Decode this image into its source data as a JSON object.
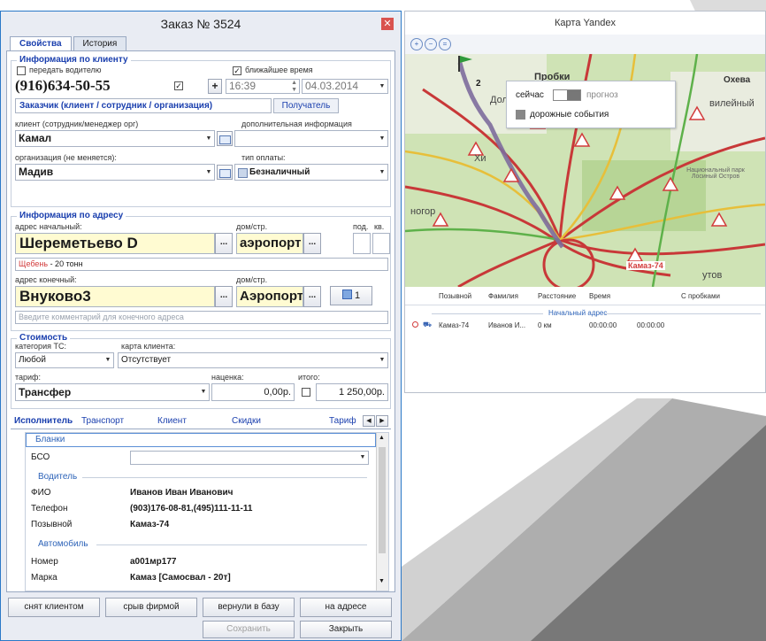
{
  "order_window": {
    "title": "Заказ № 3524",
    "close_glyph": "✕",
    "tabs": [
      {
        "label": "Свойства"
      },
      {
        "label": "История"
      }
    ],
    "client_info": {
      "legend": "Информация по клиенту",
      "pass_to_driver_label": "передать водителю",
      "nearest_time_label": "ближайшее время",
      "phone": "(916)634-50-55",
      "plus": "+",
      "time": "16:39",
      "date": "04.03.2014",
      "customer_tabs": [
        {
          "label": "Заказчик (клиент / сотрудник / организация)"
        },
        {
          "label": "Получатель"
        }
      ],
      "client_label": "клиент (сотрудник/менеджер орг)",
      "additional_label": "дополнительная информация",
      "client_value": "Камал",
      "organization_label": "организация (не меняется):",
      "payment_label": "тип оплаты:",
      "organization_value": "Мадив",
      "payment_value": "Безналичный"
    },
    "address_info": {
      "legend": "Информация по адресу",
      "start_label": "адрес начальный:",
      "house_label": "дом/стр.",
      "entrance_label": "под.",
      "apt_label": "кв.",
      "start_value": "Шереметьево D",
      "start_house": "аэропорт",
      "ellipsis": "...",
      "cargo_note_highlight": "Щебень",
      "cargo_note_rest": " - 20 тонн",
      "end_label": "адрес конечный:",
      "end_house_label": "дом/стр.",
      "end_value": "Внуково3",
      "end_house": "Аэропорт",
      "points_button": "1",
      "end_comment_placeholder": "Введите комментарий для конечного адреса"
    },
    "cost": {
      "legend": "Стоимость",
      "vehicle_cat_label": "категория ТС:",
      "client_card_label": "карта клиента:",
      "vehicle_cat_value": "Любой",
      "client_card_value": "Отсутствует",
      "tariff_label": "тариф:",
      "markup_label": "наценка:",
      "total_label": "итого:",
      "tariff_value": "Трансфер",
      "markup_value": "0,00р.",
      "total_value": "1 250,00р."
    },
    "sub_tabs": [
      {
        "label": "Исполнитель"
      },
      {
        "label": "Транспорт"
      },
      {
        "label": "Клиент"
      },
      {
        "label": "Скидки"
      },
      {
        "label": "Тариф"
      }
    ],
    "executor": {
      "blanks_label": "Бланки",
      "bso_label": "БСО",
      "driver_label": "Водитель",
      "fio_label": "ФИО",
      "fio_value": "Иванов Иван Иванович",
      "phone_label": "Телефон",
      "phone_value": "(903)176-08-81,(495)111-11-11",
      "callsign_label": "Позывной",
      "callsign_value": "Камаз-74",
      "vehicle_label": "Автомобиль",
      "plate_label": "Номер",
      "plate_value": "а001мр177",
      "brand_label": "Марка",
      "brand_value": "Камаз [Самосвал - 20т]"
    },
    "bottom_buttons": [
      {
        "label": "снят клиентом"
      },
      {
        "label": "срыв фирмой"
      },
      {
        "label": "вернули в базу"
      },
      {
        "label": "на адресе"
      }
    ],
    "save_label": "Сохранить",
    "close_label": "Закрыть"
  },
  "map_window": {
    "title": "Карта Yandex",
    "legend": {
      "now_label": "сейчас",
      "forecast_label": "прогноз",
      "road_events_label": "дорожные события"
    },
    "map_labels": {
      "traffic": "Пробки",
      "now_small": "2",
      "dol": "Дол",
      "kh": "Хи",
      "ogorod": "ногор",
      "oxeva": "Охева",
      "vileyny": "вилейный",
      "national_park": "Национальный парк Лосиный Остров",
      "kamaz_marker": "Камаз-74",
      "ytov": "утов"
    },
    "grid_headers": [
      {
        "label": "Позывной"
      },
      {
        "label": "Фамилия"
      },
      {
        "label": "Расстояние"
      },
      {
        "label": "Время"
      },
      {
        "label": "С пробками"
      }
    ],
    "group_row": "Начальный адрес",
    "rows": [
      {
        "callsign": "Камаз-74",
        "surname": "Иванов И...",
        "distance": "0 км",
        "time": "00:00:00",
        "with_traffic": "00:00:00"
      }
    ]
  },
  "colors": {
    "accent_blue": "#1a3fae",
    "field_yellow": "#fffbd2",
    "titlebar_blue": "#2b79c8",
    "close_red": "#d9534f"
  }
}
